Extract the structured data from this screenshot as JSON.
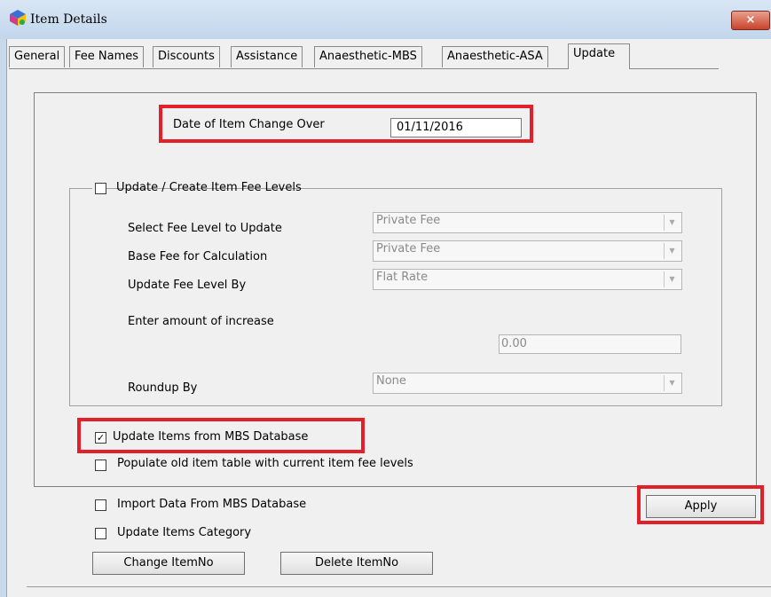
{
  "window": {
    "title": "Item Details",
    "close_label": "×",
    "icon": "app-cube-icon"
  },
  "tabs": [
    {
      "label": "General",
      "active": false
    },
    {
      "label": "Fee Names",
      "active": false
    },
    {
      "label": "Discounts",
      "active": false
    },
    {
      "label": "Assistance",
      "active": false
    },
    {
      "label": "Anaesthetic-MBS",
      "active": false
    },
    {
      "label": "Anaesthetic-ASA",
      "active": false
    },
    {
      "label": "Update",
      "active": true
    }
  ],
  "changeover": {
    "label": "Date of Item Change Over",
    "value": "01/11/2016"
  },
  "fee_levels": {
    "group_label": "Update / Create Item Fee Levels",
    "checked": false,
    "select_fee_level_label": "Select Fee Level to Update",
    "select_fee_level_value": "Private Fee",
    "base_fee_label": "Base Fee for Calculation",
    "base_fee_value": "Private Fee",
    "update_by_label": "Update Fee Level By",
    "update_by_value": "Flat Rate",
    "increase_label": "Enter amount of increase",
    "increase_value": "0.00",
    "roundup_label": "Roundup By",
    "roundup_value": "None"
  },
  "options": {
    "update_mbs_label": "Update Items from MBS Database",
    "update_mbs_checked": true,
    "populate_old_label": "Populate old item table with current item fee levels",
    "populate_old_checked": false,
    "import_label": "Import Data From MBS Database",
    "import_checked": false,
    "update_category_label": "Update Items Category",
    "update_category_checked": false
  },
  "buttons": {
    "apply": "Apply",
    "change_itemno": "Change ItemNo",
    "delete_itemno": "Delete ItemNo"
  },
  "glyphs": {
    "check": "✓",
    "dropdown_arrow": "▼"
  },
  "colors": {
    "highlight": "#e2202a",
    "close_button": "#c9432b",
    "titlebar": "#c2d6ec"
  }
}
